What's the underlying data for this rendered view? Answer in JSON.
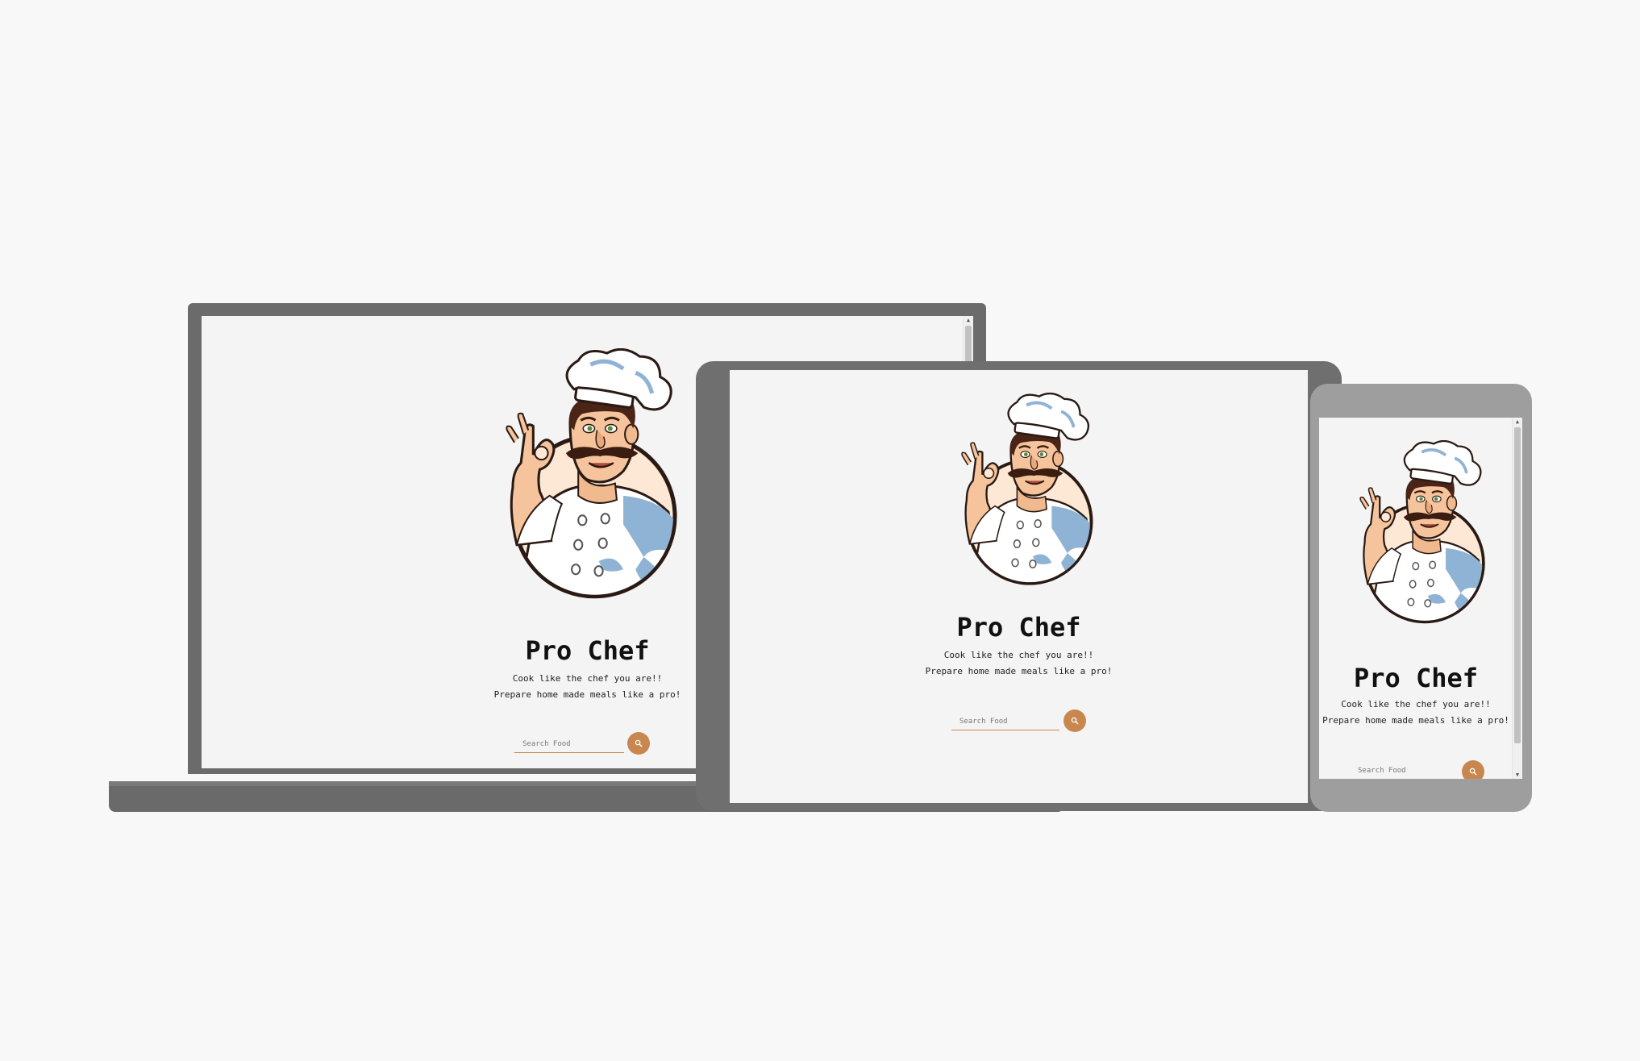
{
  "brand": {
    "title": "Pro Chef",
    "tagline_1": "Cook like the chef you are!!",
    "tagline_2": "Prepare home made meals like a pro!"
  },
  "search": {
    "placeholder": "Search Food",
    "button_icon": "search-icon"
  },
  "hero_image": "chef-mascot-illustration",
  "scroll_arrows": {
    "up": "▲",
    "down": "▼"
  },
  "colors": {
    "accent": "#c8874e",
    "background": "#f8f8f8",
    "screen": "#f4f4f4",
    "laptop_frame": "#6b6b6b",
    "tablet_frame": "#6f6f6f",
    "phone_frame": "#9e9e9e"
  }
}
